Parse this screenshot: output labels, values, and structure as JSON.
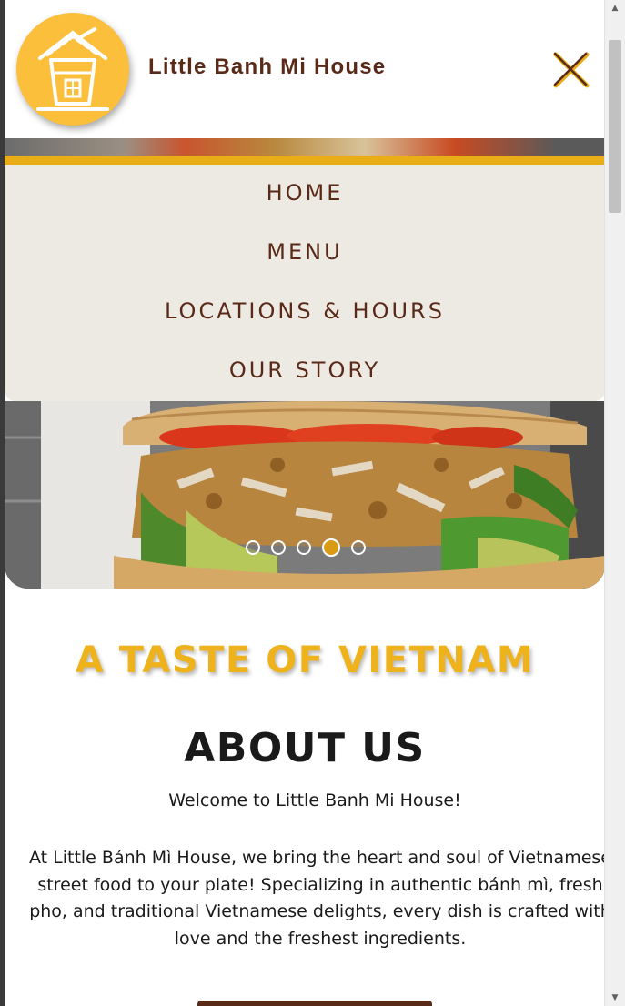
{
  "header": {
    "brand_name": "Little Banh Mi House"
  },
  "nav": {
    "items": [
      {
        "label": "HOME"
      },
      {
        "label": "MENU"
      },
      {
        "label": "LOCATIONS & HOURS"
      },
      {
        "label": "OUR STORY"
      }
    ]
  },
  "carousel": {
    "slide_count": 5,
    "active_slide": 4
  },
  "content": {
    "tagline": "A TASTE OF VIETNAM",
    "about_title": "ABOUT US",
    "welcome": "Welcome to Little Banh Mi House!",
    "body_lines": [
      "At Little Bánh Mì House, we bring the heart and soul of Vietnamese",
      "street food to your plate! Specializing in authentic bánh mì, fresh",
      "pho, and traditional Vietnamese delights, every dish is crafted with",
      "love and the freshest ingredients."
    ]
  },
  "colors": {
    "brand_brown": "#5a2a18",
    "accent_gold": "#e8ad17",
    "logo_yellow": "#fbbf3c",
    "menu_bg": "#ede9e3"
  },
  "icons": {
    "close": "close-x-icon",
    "logo": "banh-mi-house-drink-logo"
  }
}
